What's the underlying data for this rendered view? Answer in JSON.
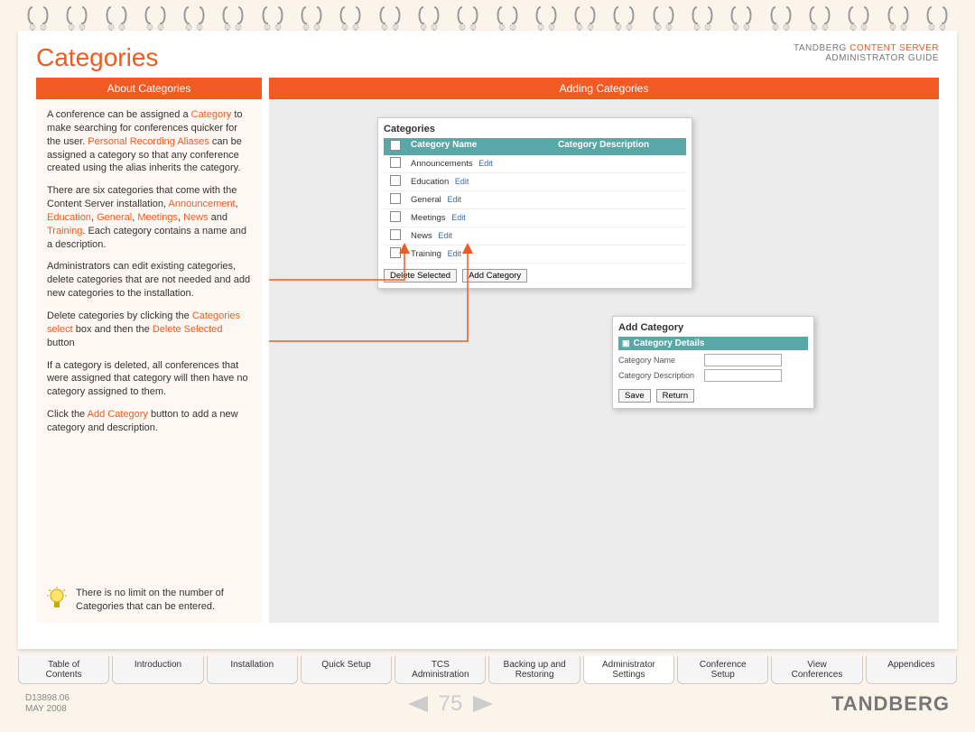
{
  "header": {
    "title": "Categories",
    "brand_line1_a": "TANDBERG ",
    "brand_line1_b": "CONTENT SERVER",
    "brand_line2": "ADMINISTRATOR GUIDE"
  },
  "tabs": {
    "left": "About Categories",
    "right": "Adding Categories"
  },
  "about": {
    "p1a": "A conference can be assigned a ",
    "p1b": "Category",
    "p1c": " to make searching for conferences quicker for the user. ",
    "p1d": "Personal Recording Aliases",
    "p1e": " can be assigned a category so that any conference created using the alias inherits the category.",
    "p2a": "There are six categories that come with the Content Server installation, ",
    "p2b": "Announcement",
    "p2c": ", ",
    "p2d": "Education",
    "p2e": ", ",
    "p2f": "General",
    "p2g": ", ",
    "p2h": "Meetings",
    "p2i": ", ",
    "p2j": "News",
    "p2k": " and ",
    "p2l": "Training",
    "p2m": ". Each category contains a name and a description.",
    "p3": "Administrators can edit existing categories, delete categories that are not needed and add new categories to the installation.",
    "p4a": "Delete categories by clicking the ",
    "p4b": "Categories select",
    "p4c": " box and then the ",
    "p4d": "Delete Selected",
    "p4e": " button",
    "p5": "If a category is deleted, all conferences that were assigned that category will then have no category assigned to them.",
    "p6a": "Click the ",
    "p6b": "Add Category",
    "p6c": " button to add a new category and description.",
    "tip": "There is no limit on the number of Categories that can be entered."
  },
  "categories_panel": {
    "title": "Categories",
    "col_name": "Category Name",
    "col_desc": "Category Description",
    "rows": [
      {
        "name": "Announcements",
        "edit": "Edit"
      },
      {
        "name": "Education",
        "edit": "Edit"
      },
      {
        "name": "General",
        "edit": "Edit"
      },
      {
        "name": "Meetings",
        "edit": "Edit"
      },
      {
        "name": "News",
        "edit": "Edit"
      },
      {
        "name": "Training",
        "edit": "Edit"
      }
    ],
    "btn_delete": "Delete Selected",
    "btn_add": "Add Category"
  },
  "add_panel": {
    "title": "Add Category",
    "section": "Category Details",
    "label_name": "Category Name",
    "label_desc": "Category Description",
    "btn_save": "Save",
    "btn_return": "Return"
  },
  "nav": [
    "Table of\nContents",
    "Introduction",
    "Installation",
    "Quick Setup",
    "TCS\nAdministration",
    "Backing up and\nRestoring",
    "Administrator\nSettings",
    "Conference\nSetup",
    "View\nConferences",
    "Appendices"
  ],
  "nav_active_index": 6,
  "footer": {
    "doc_id": "D13898.06",
    "date": "MAY 2008",
    "page": "75",
    "brand": "TANDBERG"
  }
}
